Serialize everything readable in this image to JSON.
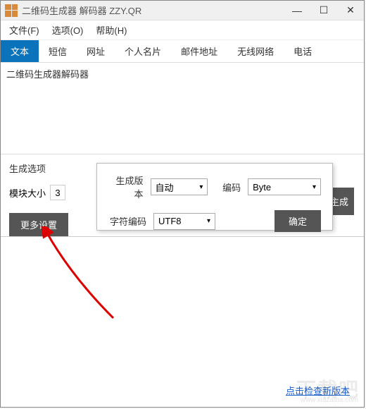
{
  "window": {
    "title": "二维码生成器 解码器 ZZY.QR"
  },
  "menu": {
    "file": "文件(F)",
    "options": "选项(O)",
    "help": "帮助(H)"
  },
  "tabs": {
    "text": "文本",
    "sms": "短信",
    "url": "网址",
    "vcard": "个人名片",
    "email": "邮件地址",
    "wifi": "无线网络",
    "phone": "电话"
  },
  "content": {
    "text": "二维码生成器解码器"
  },
  "gen_options": {
    "title": "生成选项",
    "module_size_label": "模块大小",
    "module_size_value": "3",
    "more_settings": "更多设置"
  },
  "popup": {
    "version_label": "生成版本",
    "version_value": "自动",
    "encoding_label": "编码",
    "encoding_value": "Byte",
    "charset_label": "字符编码",
    "charset_value": "UTF8",
    "confirm": "确定"
  },
  "generate_btn": "主成",
  "footer": {
    "check_update": "点击检查新版本"
  },
  "watermark": {
    "text": "下载吧",
    "url": "www.xiazaiba.com"
  }
}
